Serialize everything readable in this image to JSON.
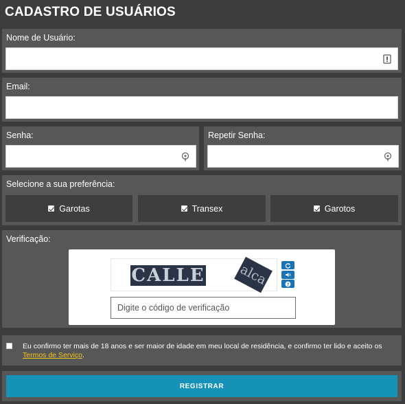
{
  "page": {
    "title": "CADASTRO DE USUÁRIOS"
  },
  "form": {
    "username": {
      "label": "Nome de Usuário:",
      "value": "",
      "placeholder": ""
    },
    "email": {
      "label": "Email:",
      "value": "",
      "placeholder": ""
    },
    "password": {
      "label": "Senha:",
      "value": "",
      "placeholder": ""
    },
    "password_repeat": {
      "label": "Repetir Senha:",
      "value": "",
      "placeholder": ""
    },
    "preference": {
      "label": "Selecione a sua preferência:",
      "options": [
        {
          "label": "Garotas",
          "checked": true
        },
        {
          "label": "Transex",
          "checked": true
        },
        {
          "label": "Garotos",
          "checked": true
        }
      ]
    },
    "verification": {
      "label": "Verificação:",
      "captcha_text_1": "CALLE",
      "captcha_text_2": "alca",
      "buttons": [
        "refresh-icon",
        "audio-icon",
        "help-icon"
      ],
      "input_placeholder": "Digite o código de verificação",
      "input_value": ""
    },
    "agreement": {
      "text": "Eu confirmo ter mais de 18 anos e ser maior de idade em meu local de residência, e confirmo ter lido e aceito os ",
      "link": "Termos de Serviço",
      "suffix": ".",
      "checked": false
    },
    "submit_label": "REGISTRAR"
  },
  "colors": {
    "background": "#3c3c3c",
    "panel": "#575757",
    "accent_button": "#1691b7",
    "link": "#f0c419",
    "captcha_buttons": "#1a73b5"
  }
}
